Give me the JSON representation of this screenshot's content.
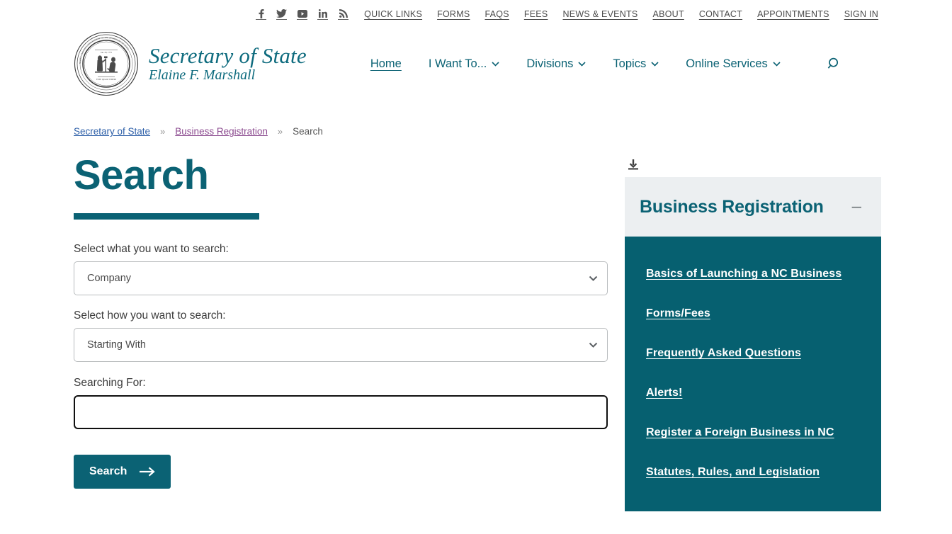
{
  "topbar": {
    "social": [
      {
        "name": "facebook-icon",
        "label": "f"
      },
      {
        "name": "twitter-icon",
        "label": "Twitter"
      },
      {
        "name": "youtube-icon",
        "label": "YouTube"
      },
      {
        "name": "linkedin-icon",
        "label": "in"
      },
      {
        "name": "rss-icon",
        "label": "RSS"
      }
    ],
    "links": [
      "QUICK LINKS",
      "FORMS",
      "FAQS",
      "FEES",
      "NEWS & EVENTS",
      "ABOUT",
      "CONTACT",
      "APPOINTMENTS",
      "SIGN IN"
    ]
  },
  "header": {
    "brand_title": "Secretary of State",
    "brand_subtitle": "Elaine F. Marshall",
    "nav": [
      {
        "label": "Home",
        "has_chevron": false,
        "active": true
      },
      {
        "label": "I Want To...",
        "has_chevron": true,
        "active": false
      },
      {
        "label": "Divisions",
        "has_chevron": true,
        "active": false
      },
      {
        "label": "Topics",
        "has_chevron": true,
        "active": false
      },
      {
        "label": "Online Services",
        "has_chevron": true,
        "active": false
      }
    ],
    "search_icon": "search-icon"
  },
  "breadcrumb": {
    "items": [
      {
        "label": "Secretary of State",
        "type": "link"
      },
      {
        "label": "Business Registration",
        "type": "visited-link"
      },
      {
        "label": "Search",
        "type": "current"
      }
    ],
    "separator": "»"
  },
  "main": {
    "title": "Search",
    "form": {
      "what_label": "Select what you want to search:",
      "what_value": "Company",
      "what_options": [
        "Company"
      ],
      "how_label": "Select how you want to search:",
      "how_value": "Starting With",
      "how_options": [
        "Starting With"
      ],
      "term_label": "Searching For:",
      "term_value": "",
      "term_placeholder": "",
      "submit_label": "Search"
    }
  },
  "sidebar": {
    "download_icon": "download-icon",
    "panel_title": "Business Registration",
    "collapse_symbol": "–",
    "links": [
      "Basics of Launching a NC Business",
      "Forms/Fees",
      "Frequently Asked Questions",
      "Alerts!",
      "Register a Foreign Business in NC",
      "Statutes, Rules, and Legislation"
    ]
  },
  "colors": {
    "teal": "#0b6274",
    "panel_body": "#066070",
    "panel_head": "#eceff1",
    "crumb_link": "#2d5fa8",
    "crumb_visited": "#8b4a8f"
  }
}
